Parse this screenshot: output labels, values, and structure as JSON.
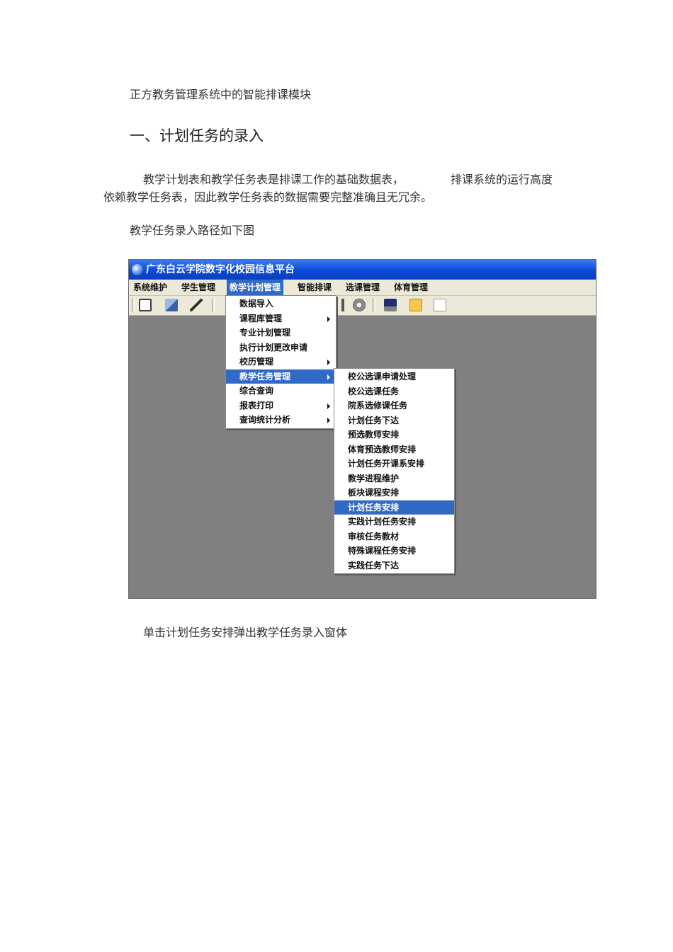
{
  "document": {
    "title": "正方教务管理系统中的智能排课模块",
    "section_heading": "一、计划任务的录入",
    "paragraph_line1": "教学计划表和教学任务表是排课工作的基础数据表，",
    "paragraph_line1_tail": "排课系统的运行高度",
    "paragraph_line2": "依赖教学任务表，因此教学任务表的数据需要完整准确且无冗余。",
    "path_caption": "教学任务录入路径如下图",
    "after_caption": "单击计划任务安排弹出教学任务录入窗体"
  },
  "app": {
    "window_title": "广东白云学院数字化校园信息平台",
    "menubar": [
      {
        "label": "系统维护"
      },
      {
        "label": "学生管理"
      },
      {
        "label": "教学计划管理",
        "active": true
      },
      {
        "label": "智能排课"
      },
      {
        "label": "选课管理"
      },
      {
        "label": "体育管理"
      }
    ],
    "toolbar_icons": [
      "edit-icon",
      "edit-page-icon",
      "pencil-icon",
      "settings-icon",
      "gear-icon",
      "computer-icon",
      "help-icon",
      "document-icon"
    ],
    "menu_level1": [
      {
        "label": "数据导入",
        "submenu": false
      },
      {
        "label": "课程库管理",
        "submenu": true
      },
      {
        "label": "专业计划管理",
        "submenu": false
      },
      {
        "label": "执行计划更改申请",
        "submenu": false
      },
      {
        "label": "校历管理",
        "submenu": true
      },
      {
        "label": "教学任务管理",
        "submenu": true,
        "active": true
      },
      {
        "label": "综合查询",
        "submenu": false
      },
      {
        "label": "报表打印",
        "submenu": true
      },
      {
        "label": "查询统计分析",
        "submenu": true
      }
    ],
    "menu_level2": [
      {
        "label": "校公选课申请处理"
      },
      {
        "label": "校公选课任务"
      },
      {
        "label": "院系选修课任务"
      },
      {
        "label": "计划任务下达"
      },
      {
        "label": "预选教师安排"
      },
      {
        "label": "体育预选教师安排"
      },
      {
        "label": "计划任务开课系安排"
      },
      {
        "label": "教学进程维护"
      },
      {
        "label": "板块课程安排"
      },
      {
        "label": "计划任务安排",
        "active": true
      },
      {
        "label": "实践计划任务安排"
      },
      {
        "label": "审核任务教材"
      },
      {
        "label": "特殊课程任务安排"
      },
      {
        "label": "实践任务下达"
      }
    ]
  }
}
